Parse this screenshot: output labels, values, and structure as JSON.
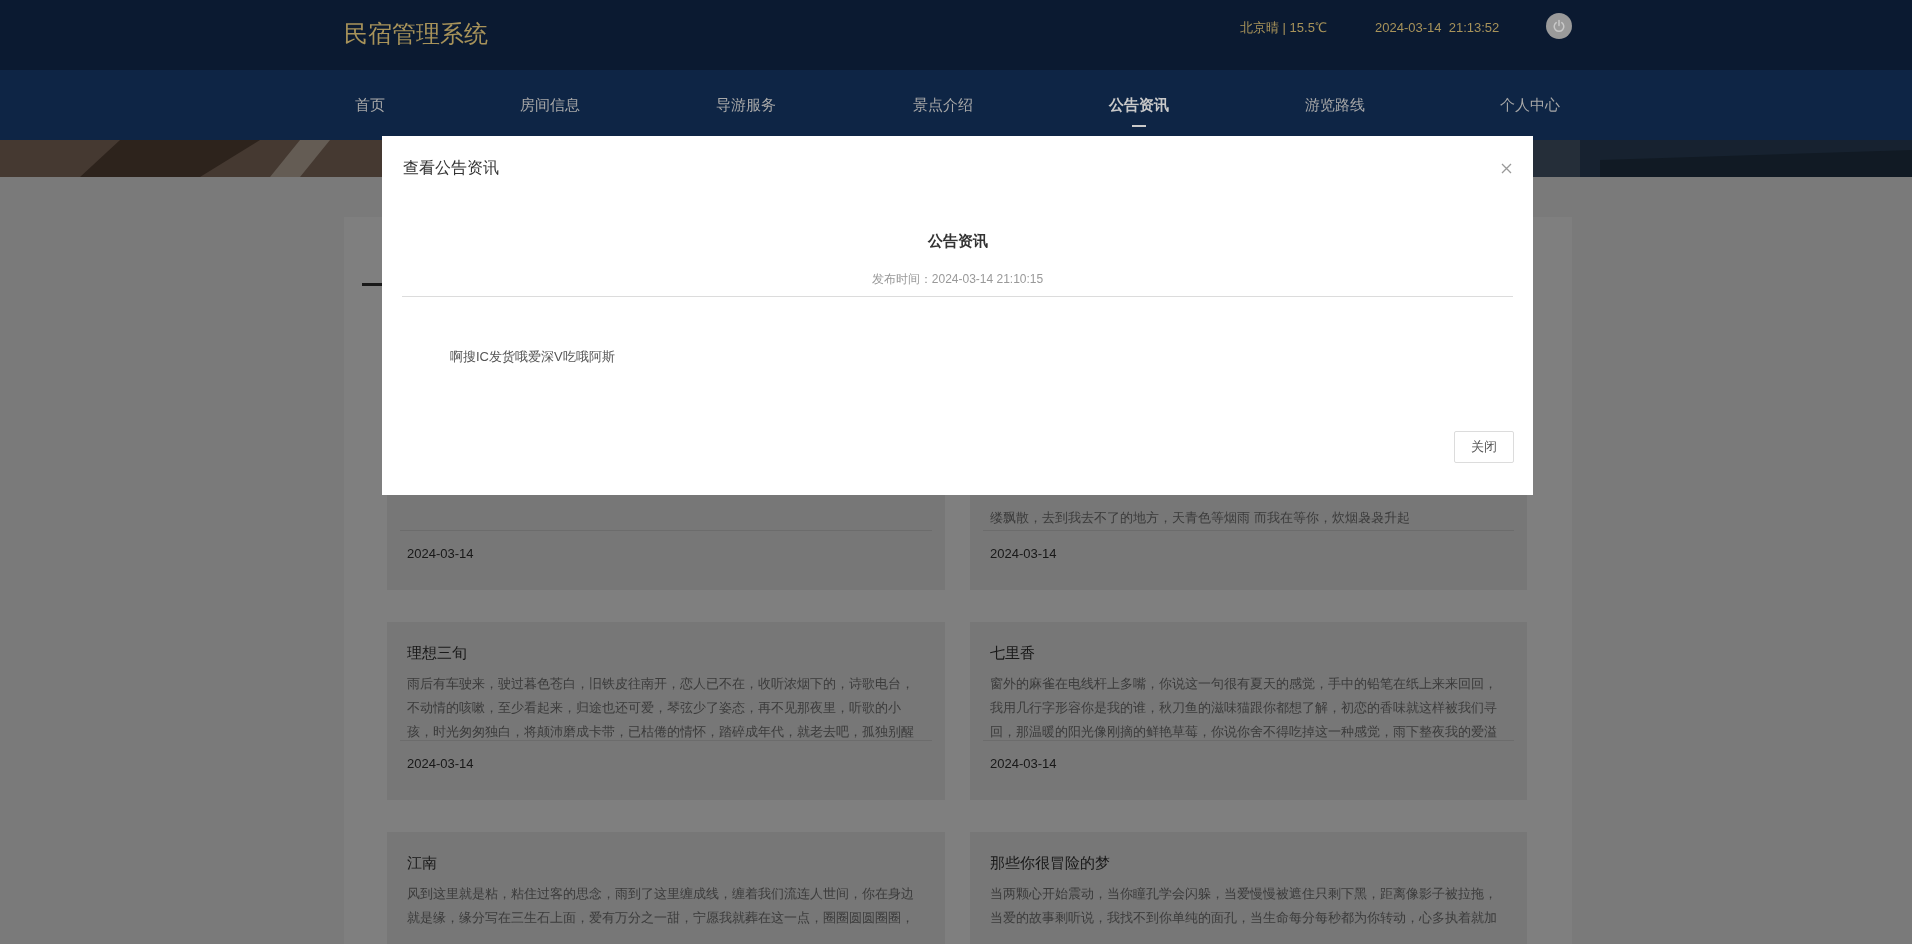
{
  "app": {
    "title": "民宿管理系统",
    "weather": "北京晴 | 15.5℃",
    "datetime": "2024-03-14  21:13:52"
  },
  "nav": [
    {
      "label": "首页",
      "selected": false
    },
    {
      "label": "房间信息",
      "selected": false
    },
    {
      "label": "导游服务",
      "selected": false
    },
    {
      "label": "景点介绍",
      "selected": false
    },
    {
      "label": "公告资讯",
      "selected": true
    },
    {
      "label": "游览路线",
      "selected": false
    },
    {
      "label": "个人中心",
      "selected": false
    }
  ],
  "card_rows": [
    {
      "cards": [
        {
          "date": "2024-03-14"
        },
        {
          "body": "缕飘散，去到我去不了的地方，天青色等烟雨 而我在等你，炊烟袅袅升起",
          "date": "2024-03-14"
        }
      ]
    },
    {
      "cards": [
        {
          "title": "理想三旬",
          "body": "雨后有车驶来，驶过暮色苍白，旧铁皮往南开，恋人已不在，收听浓烟下的，诗歌电台，不动情的咳嗽，至少看起来，归途也还可爱，琴弦少了姿态，再不见那夜里，听歌的小孩，时光匆匆独白，将颠沛磨成卡带，已枯倦的情怀，踏碎成年代，就老去吧，孤独别醒",
          "date": "2024-03-14"
        },
        {
          "title": "七里香",
          "body": "窗外的麻雀在电线杆上多嘴，你说这一句很有夏天的感觉，手中的铅笔在纸上来来回回，我用几行字形容你是我的谁，秋刀鱼的滋味猫跟你都想了解，初恋的香味就这样被我们寻回，那温暖的阳光像刚摘的鲜艳草莓，你说你舍不得吃掉这一种感觉，雨下整夜我的爱溢",
          "date": "2024-03-14"
        }
      ]
    },
    {
      "cards": [
        {
          "title": "江南",
          "body": "风到这里就是粘，粘住过客的思念，雨到了这里缠成线，缠着我们流连人世间，你在身边就是缘，缘分写在三生石上面，爱有万分之一甜，宁愿我就葬在这一点，圈圈圆圆圈圈，"
        },
        {
          "title": "那些你很冒险的梦",
          "body": "当两颗心开始震动，当你瞳孔学会闪躲，当爱慢慢被遮住只剩下黑，距离像影子被拉拖，当爱的故事剩听说，我找不到你单纯的面孔，当生命每分每秒都为你转动，心多执着就加"
        }
      ]
    }
  ],
  "modal": {
    "title": "查看公告资讯",
    "heading": "公告资讯",
    "meta": "发布时间：2024-03-14 21:10:15",
    "content": "啊搜IC发货哦爱深V吃哦阿斯",
    "buttons": [
      "关闭"
    ]
  }
}
